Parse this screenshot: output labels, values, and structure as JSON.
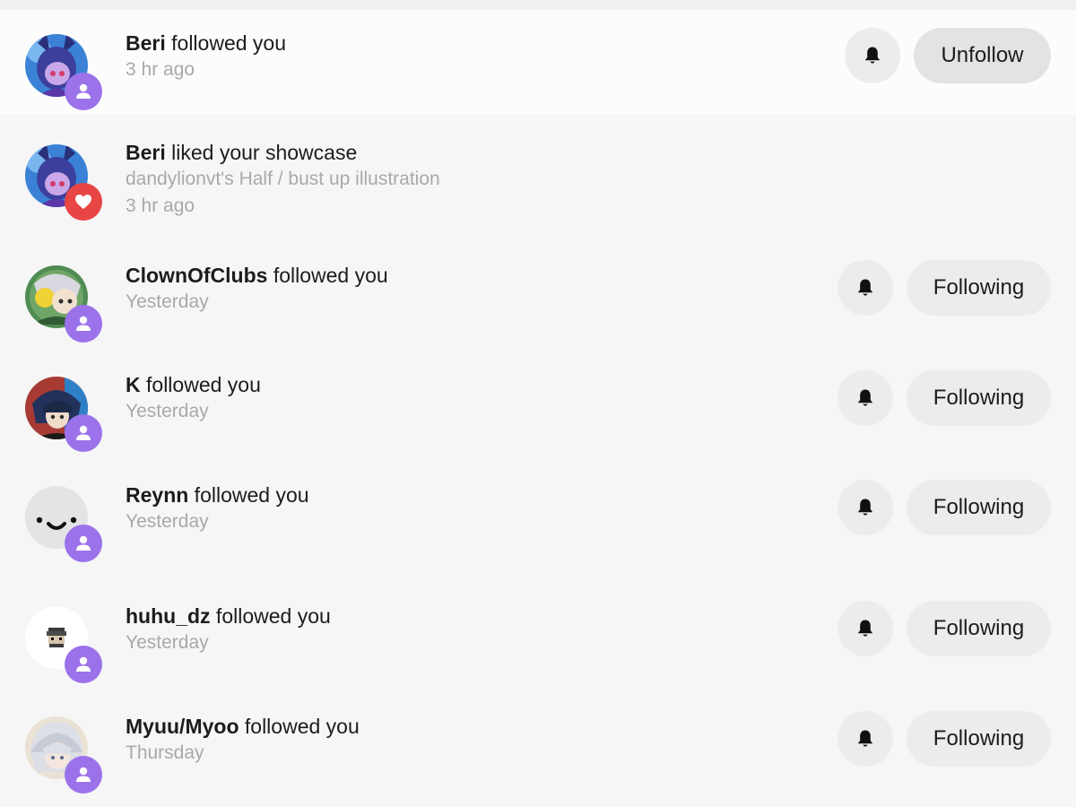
{
  "colors": {
    "follow_badge": "#9b72ea",
    "like_badge": "#e84545",
    "button_bg": "#ececee",
    "unfollow_bg": "#e3e3e5",
    "timestamp": "#a9a9ad"
  },
  "notifications": [
    {
      "name": "Beri",
      "action": " followed you",
      "time": "3 hr ago",
      "badge_icon": "person-icon",
      "bell_icon": "bell-icon",
      "button_label": "Unfollow"
    },
    {
      "name": "Beri",
      "action": " liked your showcase",
      "detail": "dandylionvt's Half / bust up illustration",
      "time": "3 hr ago",
      "badge_icon": "heart-icon"
    },
    {
      "name": "ClownOfClubs",
      "action": " followed you",
      "time": "Yesterday",
      "badge_icon": "person-icon",
      "bell_icon": "bell-icon",
      "button_label": "Following"
    },
    {
      "name": "K",
      "action": " followed you",
      "time": "Yesterday",
      "badge_icon": "person-icon",
      "bell_icon": "bell-icon",
      "button_label": "Following"
    },
    {
      "name": "Reynn",
      "action": " followed you",
      "time": "Yesterday",
      "badge_icon": "person-icon",
      "bell_icon": "bell-icon",
      "button_label": "Following"
    },
    {
      "name": "huhu_dz",
      "action": " followed you",
      "time": "Yesterday",
      "badge_icon": "person-icon",
      "bell_icon": "bell-icon",
      "button_label": "Following"
    },
    {
      "name": "Myuu/Myoo",
      "action": " followed you",
      "time": "Thursday",
      "badge_icon": "person-icon",
      "bell_icon": "bell-icon",
      "button_label": "Following"
    }
  ]
}
